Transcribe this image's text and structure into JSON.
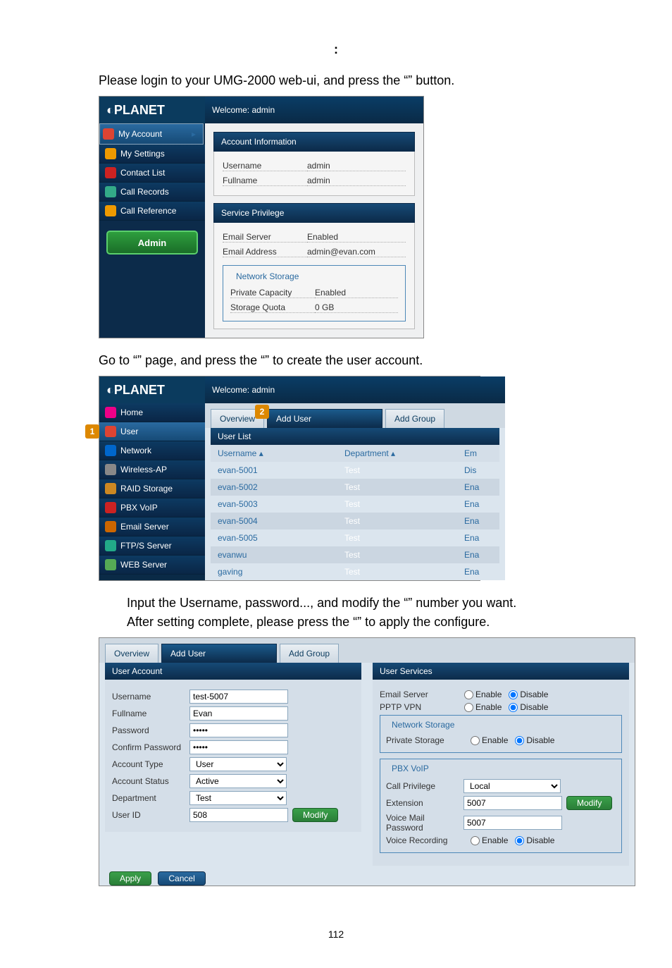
{
  "colon": ":",
  "intro1_a": "Please login to your UMG-2000 web-ui, and press the “",
  "intro1_b": "” button.",
  "intro2_a": "Go to “",
  "intro2_b": "” page, and press the “",
  "intro2_c": "” to create the user account.",
  "intro3_a": "Input the Username, password..., and modify the “",
  "intro3_b": "” number you want.",
  "intro4_a": "After setting complete, please press the “",
  "intro4_b": "” to apply the configure.",
  "brand": "PLANET",
  "welcome": "Welcome: admin",
  "ss1": {
    "sidebar": [
      "My Account",
      "My Settings",
      "Contact List",
      "Call Records",
      "Call Reference"
    ],
    "adminBtn": "Admin",
    "panel1": "Account Information",
    "rows1": [
      [
        "Username",
        "admin"
      ],
      [
        "Fullname",
        "admin"
      ]
    ],
    "panel2": "Service Privilege",
    "rows2": [
      [
        "Email Server",
        "Enabled"
      ],
      [
        "Email Address",
        "admin@evan.com"
      ]
    ],
    "fs": "Network Storage",
    "rows3": [
      [
        "Private Capacity",
        "Enabled"
      ],
      [
        "Storage Quota",
        "0 GB"
      ]
    ]
  },
  "ss2": {
    "sidebar": [
      "Home",
      "User",
      "Network",
      "Wireless-AP",
      "RAID Storage",
      "PBX VoIP",
      "Email Server",
      "FTP/S Server",
      "WEB Server"
    ],
    "tabs": [
      "Overview",
      "Add User",
      "Add Group"
    ],
    "listTitle": "User List",
    "cols": [
      "Username ▴",
      "Department ▴",
      "Em"
    ],
    "rows": [
      [
        "evan-5001",
        "Test",
        "Dis"
      ],
      [
        "evan-5002",
        "Test",
        "Ena"
      ],
      [
        "evan-5003",
        "Test",
        "Ena"
      ],
      [
        "evan-5004",
        "Test",
        "Ena"
      ],
      [
        "evan-5005",
        "Test",
        "Ena"
      ],
      [
        "evanwu",
        "Test",
        "Ena"
      ],
      [
        "gaving",
        "Test",
        "Ena"
      ]
    ]
  },
  "ss3": {
    "tabs": [
      "Overview",
      "Add User",
      "Add Group"
    ],
    "leftTitle": "User Account",
    "leftFields": {
      "Username": "test-5007",
      "Fullname": "Evan",
      "Password": "•••••",
      "Confirm Password": "•••••",
      "Account Type": "User",
      "Account Status": "Active",
      "Department": "Test",
      "User ID": "508"
    },
    "modifyBtn": "Modify",
    "rightTitle": "User Services",
    "enable": "Enable",
    "disable": "Disable",
    "svc1": [
      "Email Server",
      "PPTP VPN"
    ],
    "fsNet": "Network Storage",
    "svcNet": "Private Storage",
    "fsPbx": "PBX VoIP",
    "pbxRows": {
      "Call Privilege": "Local",
      "Extension": "5007",
      "Voice Mail Password": "5007",
      "Voice Recording": ""
    },
    "apply": "Apply",
    "cancel": "Cancel"
  },
  "pageNum": "112"
}
